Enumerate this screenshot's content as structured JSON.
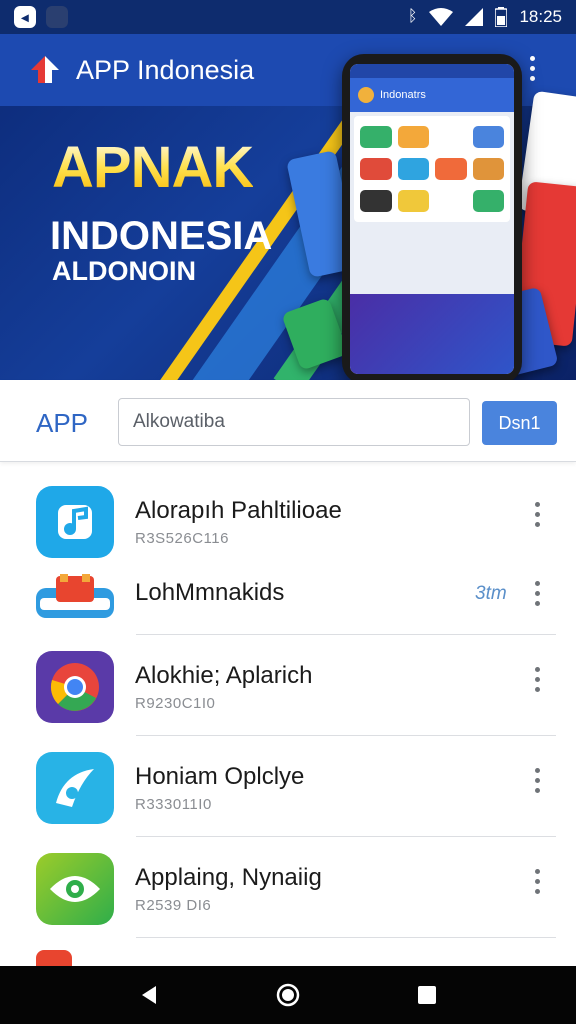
{
  "status_bar": {
    "time": "18:25",
    "icons": [
      "notification-icon",
      "bluetooth-icon",
      "wifi-icon",
      "signal-icon",
      "battery-icon"
    ]
  },
  "app_bar": {
    "title": "APP Indonesia",
    "logo_icon": "house-logo-icon",
    "more_icon": "more-vert-icon"
  },
  "banner": {
    "headline": "APNAK",
    "subheadline": "INDONESIA",
    "tagline": "ALDONOIN",
    "phone_header": "Indonatrs"
  },
  "search": {
    "label": "APP",
    "placeholder": "Alkowatiba",
    "button": "Dsn1"
  },
  "apps": [
    {
      "name": "Alorapıh Pahltilioae",
      "meta": "R3S526C116",
      "icon": "music-note-icon",
      "badge": ""
    },
    {
      "name": "LohMmnakids",
      "meta": "",
      "icon": "store-icon",
      "badge": "3tm"
    },
    {
      "name": "Alokhie; Aplarich",
      "meta": "R9230C1I0",
      "icon": "chrome-icon",
      "badge": ""
    },
    {
      "name": "Honiam Oplclye",
      "meta": "R333011I0",
      "icon": "paper-plane-icon",
      "badge": ""
    },
    {
      "name": "Applaing, Nynaiig",
      "meta": "R2539 DI6",
      "icon": "eye-icon",
      "badge": ""
    }
  ],
  "nav": {
    "back": "back-icon",
    "home": "home-icon",
    "recents": "recents-icon"
  },
  "colors": {
    "primary": "#1d4ab1",
    "accent_button": "#4a84dd",
    "banner_dark": "#0c2a78",
    "headline_yellow": "#f7b400"
  }
}
